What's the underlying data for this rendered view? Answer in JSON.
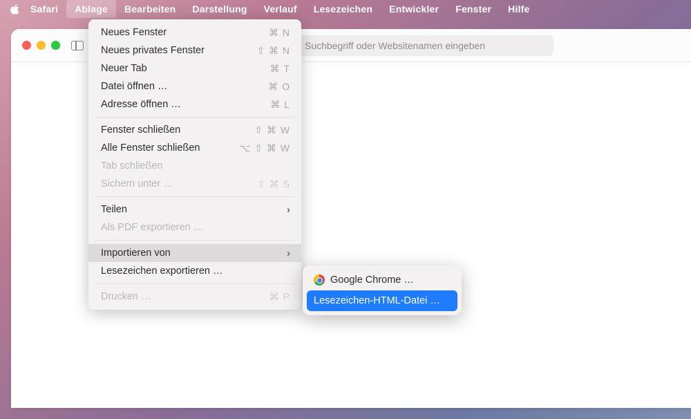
{
  "menubar": {
    "app": "Safari",
    "items": [
      "Ablage",
      "Bearbeiten",
      "Darstellung",
      "Verlauf",
      "Lesezeichen",
      "Entwickler",
      "Fenster",
      "Hilfe"
    ],
    "active": "Ablage"
  },
  "toolbar": {
    "search_placeholder": "Suchbegriff oder Websitenamen eingeben"
  },
  "menu": {
    "groups": [
      [
        {
          "label": "Neues Fenster",
          "sc": "⌘ N"
        },
        {
          "label": "Neues privates Fenster",
          "sc": "⇧ ⌘ N"
        },
        {
          "label": "Neuer Tab",
          "sc": "⌘ T"
        },
        {
          "label": "Datei öffnen …",
          "sc": "⌘ O"
        },
        {
          "label": "Adresse öffnen …",
          "sc": "⌘ L"
        }
      ],
      [
        {
          "label": "Fenster schließen",
          "sc": "⇧ ⌘ W"
        },
        {
          "label": "Alle Fenster schließen",
          "sc": "⌥ ⇧ ⌘ W"
        },
        {
          "label": "Tab schließen",
          "disabled": true
        },
        {
          "label": "Sichern unter …",
          "sc": "⇧ ⌘ S",
          "disabled": true
        }
      ],
      [
        {
          "label": "Teilen",
          "submenu": true
        },
        {
          "label": "Als PDF exportieren …",
          "disabled": true
        }
      ],
      [
        {
          "label": "Importieren von",
          "submenu": true,
          "hover": true
        },
        {
          "label": "Lesezeichen exportieren …"
        }
      ],
      [
        {
          "label": "Drucken …",
          "sc": "⌘ P",
          "disabled": true
        }
      ]
    ]
  },
  "submenu": {
    "items": [
      {
        "label": "Google Chrome …",
        "icon": "chrome"
      },
      {
        "label": "Lesezeichen-HTML-Datei …",
        "selected": true
      }
    ]
  }
}
